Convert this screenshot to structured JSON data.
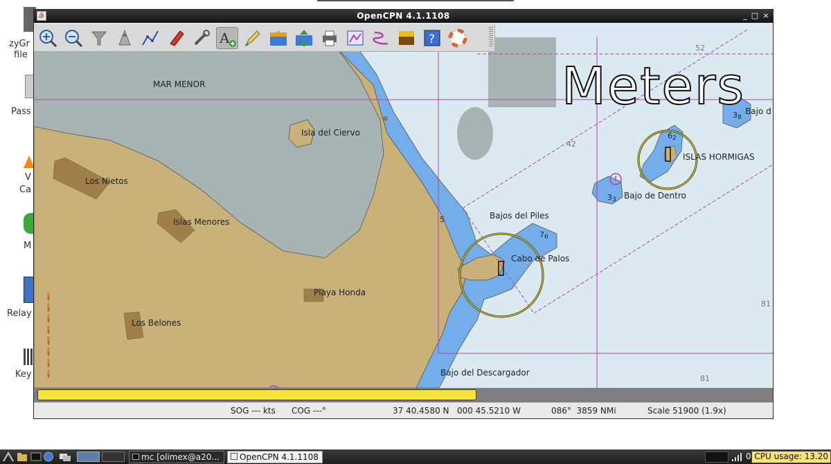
{
  "desktop": {
    "icons": [
      {
        "name": "zyGrib",
        "lines": [
          "zyGr",
          "file"
        ]
      },
      {
        "name": "Pass",
        "lines": [
          "Pass"
        ]
      },
      {
        "name": "VLC",
        "lines": [
          "V",
          "Ca"
        ]
      },
      {
        "name": "M",
        "lines": [
          "M"
        ]
      },
      {
        "name": "Relay",
        "lines": [
          "Relay"
        ]
      },
      {
        "name": "Key",
        "lines": [
          "Key"
        ]
      }
    ]
  },
  "window": {
    "title": "OpenCPN 4.1.1108",
    "controls": {
      "minimize": "_",
      "maximize": "□",
      "close": "×"
    }
  },
  "toolbar": {
    "buttons": [
      {
        "id": "zoom-in",
        "icon": "zoom-in-icon"
      },
      {
        "id": "zoom-out",
        "icon": "zoom-out-icon"
      },
      {
        "id": "chart-quilt",
        "icon": "funnel-icon"
      },
      {
        "id": "anchor",
        "icon": "ship-icon"
      },
      {
        "id": "route",
        "icon": "route-icon"
      },
      {
        "id": "follow",
        "icon": "boat-icon"
      },
      {
        "id": "settings",
        "icon": "wrench-icon"
      },
      {
        "id": "text",
        "icon": "text-add-icon",
        "active": true
      },
      {
        "id": "mark",
        "icon": "pencil-icon"
      },
      {
        "id": "tide",
        "icon": "tide-icon"
      },
      {
        "id": "current",
        "icon": "current-icon"
      },
      {
        "id": "print",
        "icon": "print-icon"
      },
      {
        "id": "route-manager",
        "icon": "route-manager-icon"
      },
      {
        "id": "track",
        "icon": "track-icon"
      },
      {
        "id": "color",
        "icon": "color-scheme-icon"
      },
      {
        "id": "help",
        "icon": "help-icon"
      },
      {
        "id": "mob",
        "icon": "lifebuoy-icon"
      }
    ]
  },
  "chart": {
    "overlay_text": "Meters",
    "labels": {
      "mar_menor": "MAR MENOR",
      "isla_ciervo": "Isla del Ciervo",
      "los_nietos": "Los Nietos",
      "islas_menores": "Islas Menores",
      "playa_honda": "Playa Honda",
      "los_belones": "Los Belones",
      "bajos_piles": "Bajos del Piles",
      "cabo_palos": "Cabo de Palos",
      "bajo_dentro": "Bajo de Dentro",
      "islas_hormigas": "ISLAS HORMIGAS",
      "bajo_descargador": "Bajo del Descargador",
      "bajo_d": "Bajo d"
    },
    "depths": {
      "d52": "52",
      "d42": "42",
      "d81a": "81",
      "d81b": "81",
      "d5": "5",
      "d76": "7",
      "d76s": "6",
      "d62": "6",
      "d62s": "2",
      "d33": "3",
      "d33s": "3",
      "d38": "3",
      "d38s": "8"
    }
  },
  "status": {
    "progress": 0.6,
    "sog": "SOG --- kts",
    "cog": "COG ---°",
    "position": "37 40.4580 N   000 45.5210 W",
    "bearing": "086°  3859 NMi",
    "scale": "Scale 51900 (1.9x)"
  },
  "taskbar": {
    "tasks": [
      {
        "label": "mc [olimex@a20...",
        "active": false
      },
      {
        "label": "OpenCPN 4.1.1108",
        "active": true
      }
    ],
    "cpu": "CPU usage: 13.20",
    "tray_number": "0"
  },
  "colors": {
    "land": "#c9b27a",
    "deep_water": "#dbeaf0",
    "shallow_water": "#74aeea",
    "mar_menor": "#a8b3b3",
    "boundary": "#b43fb4",
    "light_ring": "#d2c21a"
  }
}
